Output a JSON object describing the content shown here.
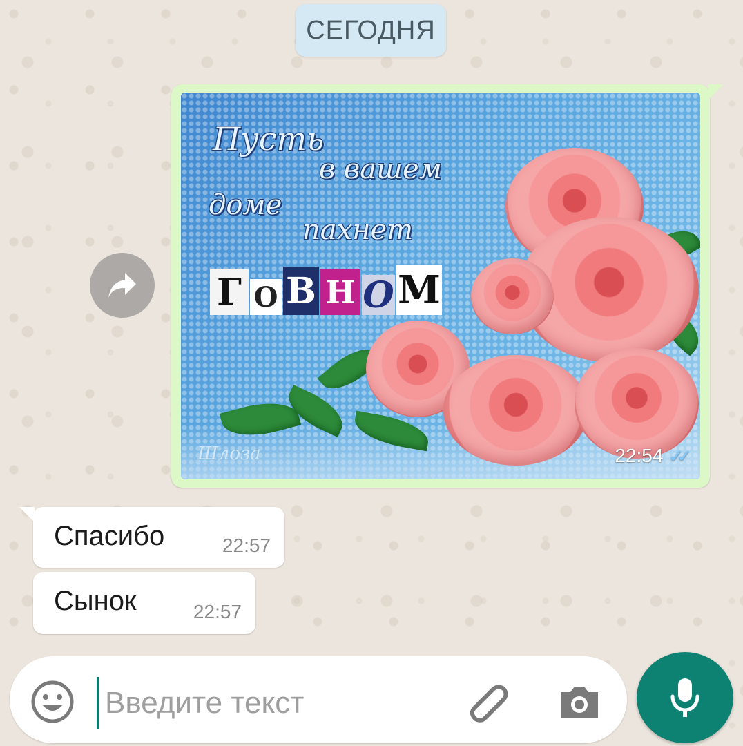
{
  "date_chip": "СЕГОДНЯ",
  "image_message": {
    "caption_lines": [
      "Пусть",
      "в вашем",
      "доме",
      "пахнет"
    ],
    "ransom_letters": [
      "Г",
      "О",
      "В",
      "Н",
      "О",
      "М"
    ],
    "watermark": "Шлоза",
    "time": "22:54",
    "status": "read",
    "check_icon": "double-check-icon"
  },
  "messages": [
    {
      "text": "Спасибо",
      "time": "22:57"
    },
    {
      "text": "Сынок",
      "time": "22:57"
    }
  ],
  "composer": {
    "placeholder": "Введите текст",
    "emoji_icon": "emoji-icon",
    "attach_icon": "paperclip-icon",
    "camera_icon": "camera-icon",
    "mic_icon": "microphone-icon"
  },
  "colors": {
    "wallpaper": "#ece5dd",
    "outgoing_bubble": "#dcf8c6",
    "incoming_bubble": "#ffffff",
    "date_chip": "#d5e9f4",
    "accent": "#0e8272",
    "read_check": "#7fc7ff"
  }
}
